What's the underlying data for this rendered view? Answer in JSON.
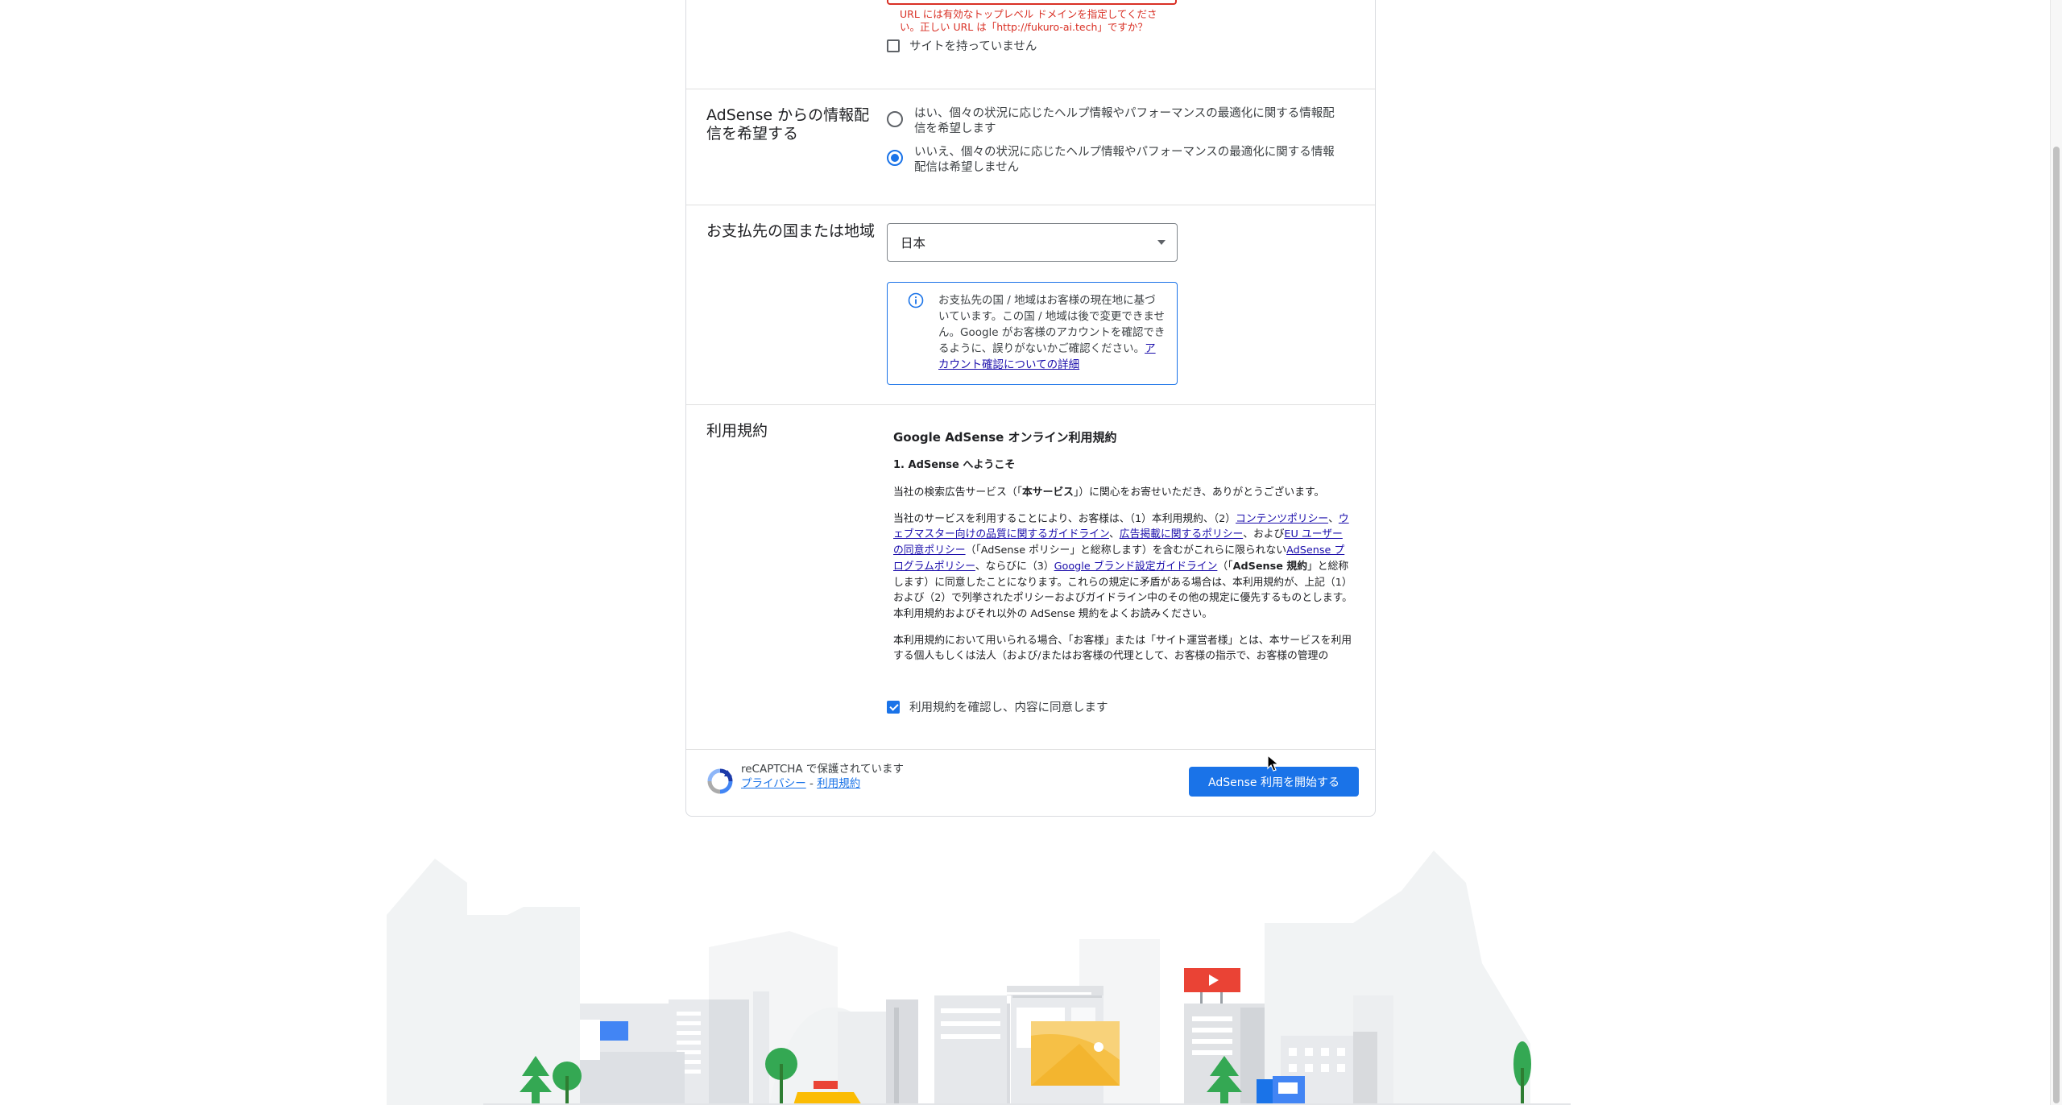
{
  "url_section": {
    "error_text": "URL には有効なトップレベル ドメインを指定してください。正しい URL は「http://fukuro-ai.tech」ですか？",
    "no_site_label": "サイトを持っていません"
  },
  "info_section": {
    "label": "AdSense からの情報配信を希望する",
    "options": [
      {
        "text": "はい、個々の状況に応じたヘルプ情報やパフォーマンスの最適化に関する情報配信を希望します",
        "selected": false
      },
      {
        "text": "いいえ、個々の状況に応じたヘルプ情報やパフォーマンスの最適化に関する情報配信は希望しません",
        "selected": true
      }
    ]
  },
  "payment_section": {
    "label": "お支払先の国または地域",
    "selected_country": "日本",
    "info_text": "お支払先の国 / 地域はお客様の現在地に基づいています。この国 / 地域は後で変更できません。Google がお客様のアカウントを確認できるように、誤りがないかご確認ください。",
    "info_link": "アカウント確認についての詳細"
  },
  "terms_section": {
    "label": "利用規約",
    "title": "Google AdSense オンライン利用規約",
    "heading1": "1. AdSense へようこそ",
    "p1_pre": "当社の検索広告サービス（「",
    "p1_bold": "本サービス",
    "p1_post": "」）に関心をお寄せいただき、ありがとうございます。",
    "p2_a": "当社のサービスを利用することにより、お客様は、（1）本利用規約、（2）",
    "link_content_policy": "コンテンツポリシー",
    "p2_b": "、",
    "link_webmaster": "ウェブマスター向けの品質に関するガイドライン",
    "p2_c": "、",
    "link_ad_policy": "広告掲載に関するポリシー",
    "p2_d": "、および",
    "link_eu": "EU ユーザーの同意ポリシー",
    "p2_e": "（「AdSense ポリシー」と総称します）を含むがこれらに限られない",
    "link_program": "AdSense プログラムポリシー",
    "p2_f": "、ならびに（3）",
    "link_brand": "Google ブランド設定ガイドライン",
    "p2_g": "（「",
    "p2_bold": "AdSense 規約",
    "p2_h": "」と総称します）に同意したことになります。これらの規定に矛盾がある場合は、本利用規約が、上記（1）および（2）で列挙されたポリシーおよびガイドライン中のその他の規定に優先するものとします。本利用規約およびそれ以外の AdSense 規約をよくお読みください。",
    "p3": "本利用規約において用いられる場合、「お客様」または「サイト運営者様」とは、本サービスを利用する個人もしくは法人（および/またはお客様の代理として、お客様の指示で、お客様の管理の",
    "agree_label": "利用規約を確認し、内容に同意します"
  },
  "footer": {
    "recaptcha_text": "reCAPTCHA で保護されています",
    "privacy_link": "プライバシー",
    "separator": " - ",
    "terms_link": "利用規約",
    "start_button": "AdSense 利用を開始する"
  },
  "colors": {
    "primary": "#1a73e8",
    "error": "#d93025",
    "border": "#dadce0"
  }
}
